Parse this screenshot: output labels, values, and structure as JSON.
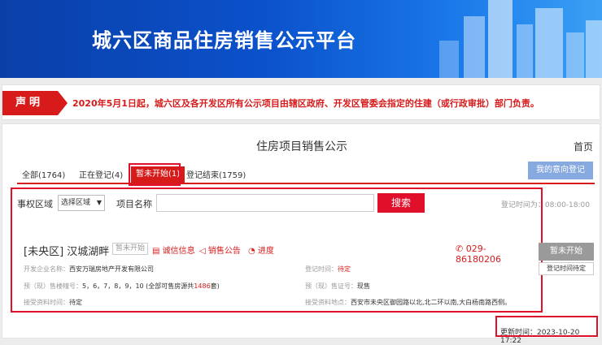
{
  "header": {
    "title": "城六区商品住房销售公示平台"
  },
  "notice": {
    "tag": "声明",
    "text": "2020年5月1日起，城六区及各开发区所有公示项目由辖区政府、开发区管委会指定的住建（或行政审批）部门负责。"
  },
  "page": {
    "title": "住房项目销售公示",
    "home_link": "首页"
  },
  "tabs": [
    {
      "label": "全部(1764)"
    },
    {
      "label": "正在登记(4)"
    },
    {
      "label": "暂未开始(1)",
      "active": true
    },
    {
      "label": "登记结束(1759)"
    }
  ],
  "intent_button": "我的意向登记",
  "search": {
    "district_label": "事权区域",
    "district_select": "选择区域",
    "name_label": "项目名称",
    "name_value": "",
    "search_button": "搜索",
    "register_hours": "登记时间为：08:00-18:00"
  },
  "project": {
    "name": "[未央区] 汉城湖畔",
    "status": "暂未开始",
    "link_credit": "诚信信息",
    "link_announcement": "销售公告",
    "link_progress": "进度",
    "phone": "029-86180206",
    "developer_label": "开发企业名称：",
    "developer": "西安万瑞房地产开发有限公司",
    "buildings_label": "预（现）售楼幢号：",
    "buildings": "5，6，7，8，9，10 (全部可售房源共",
    "units": "1486",
    "units_suffix": "套)",
    "accept_time_label": "接受资料时间：",
    "accept_time": "待定",
    "register_time_label": "登记时间：",
    "register_time": "待定",
    "license_label": "预（现）售证号：",
    "license": "现售",
    "address_label": "接受资料地点：",
    "address": "西安市未央区御园路以北,北二环以南,大白杨南路西侧。",
    "status_button": "暂未开始",
    "status_note": "登记时间待定"
  },
  "updated": "更新时间：2023-10-20 17:22",
  "colors": {
    "accent": "#d71a1a",
    "banner": "#0b52cc",
    "intent": "#86a9e0"
  }
}
